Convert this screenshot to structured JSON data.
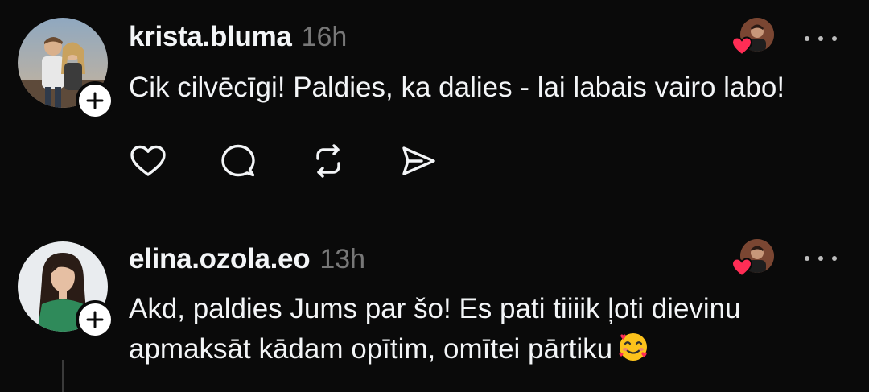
{
  "posts": [
    {
      "username": "krista.bluma",
      "time": "16h",
      "text": "Cik cilvēcīgi! Paldies, ka dalies - lai labais vairo labo!",
      "liked_by_author": true,
      "actions": [
        "heart-icon",
        "comment-icon",
        "repost-icon",
        "share-icon"
      ]
    },
    {
      "username": "elina.ozola.eo",
      "time": "13h",
      "text": "Akd, paldies Jums par šo! Es pati tiiiik ļoti dievinu apmaksāt kādam opītim, omītei pārtiku",
      "emoji": "smiling-face-with-hearts",
      "liked_by_author": true
    }
  ],
  "colors": {
    "background": "#0a0a0a",
    "text": "#f3f5f7",
    "muted": "#777777",
    "heart_red": "#ff2d55",
    "divider": "#2a2a2a"
  }
}
